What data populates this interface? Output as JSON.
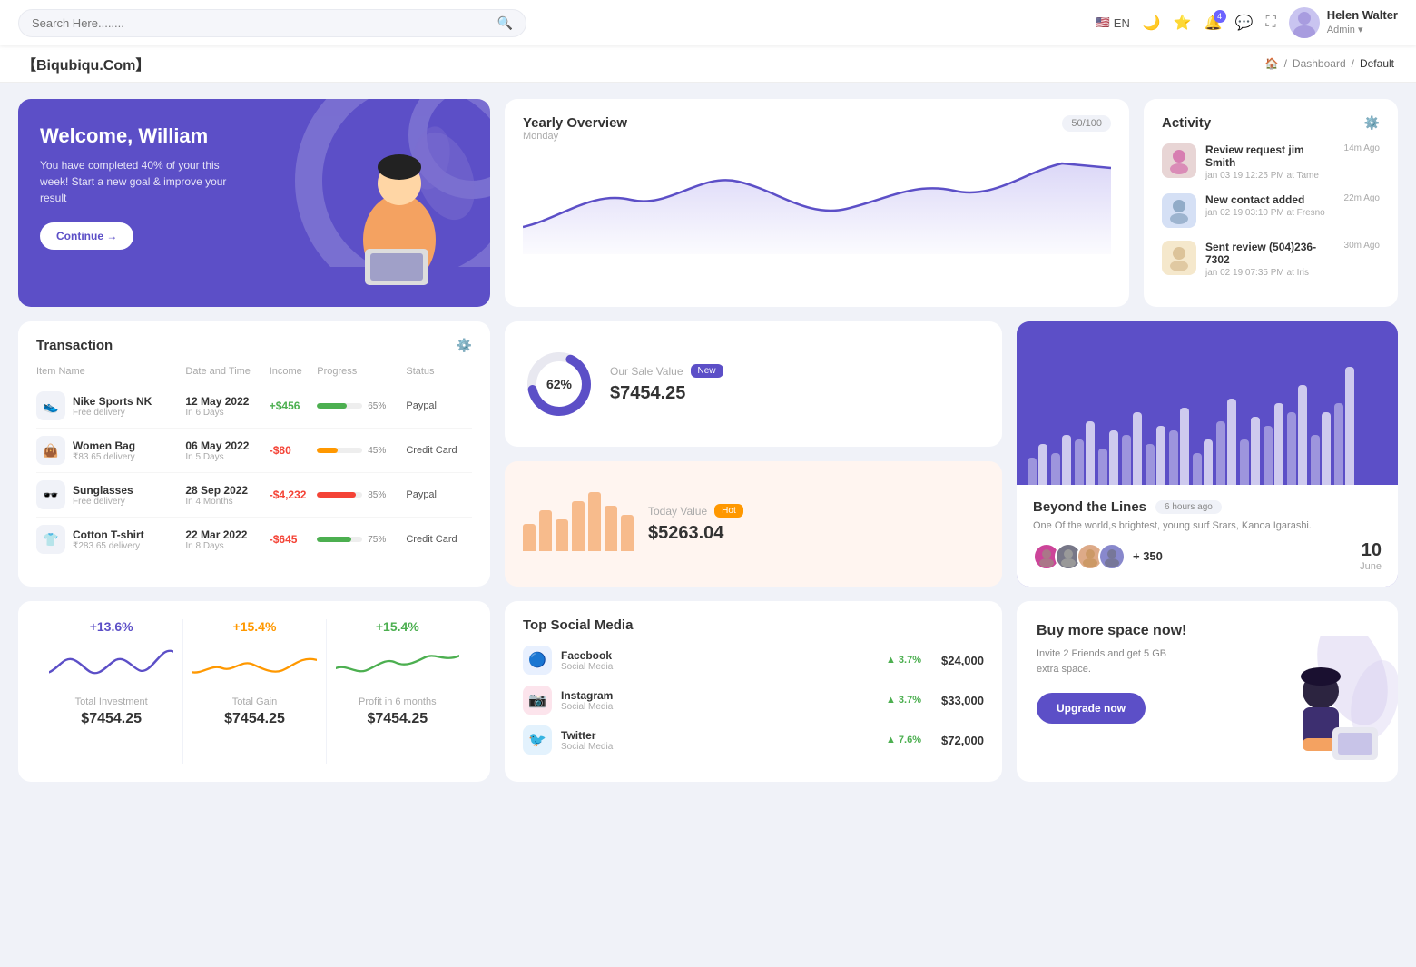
{
  "header": {
    "search_placeholder": "Search Here........",
    "lang": "EN",
    "notification_count": "4",
    "user_name": "Helen Walter",
    "user_role": "Admin"
  },
  "breadcrumb": {
    "brand": "【Biqubiqu.Com】",
    "path": [
      "Home",
      "Dashboard",
      "Default"
    ]
  },
  "welcome": {
    "title": "Welcome, William",
    "description": "You have completed 40% of your this week! Start a new goal & improve your result",
    "button": "Continue →"
  },
  "yearly_overview": {
    "title": "Yearly Overview",
    "subtitle": "Monday",
    "badge": "50/100"
  },
  "activity": {
    "title": "Activity",
    "items": [
      {
        "title": "Review request jim Smith",
        "desc": "jan 03 19 12:25 PM at Tame",
        "time": "14m Ago"
      },
      {
        "title": "New contact added",
        "desc": "jan 02 19 03:10 PM at Fresno",
        "time": "22m Ago"
      },
      {
        "title": "Sent review (504)236-7302",
        "desc": "jan 02 19 07:35 PM at Iris",
        "time": "30m Ago"
      }
    ]
  },
  "transaction": {
    "title": "Transaction",
    "columns": [
      "Item Name",
      "Date and Time",
      "Income",
      "Progress",
      "Status"
    ],
    "rows": [
      {
        "icon": "👟",
        "name": "Nike Sports NK",
        "sub": "Free delivery",
        "date": "12 May 2022",
        "period": "In 6 Days",
        "income": "+$456",
        "income_type": "pos",
        "progress": 65,
        "progress_color": "#4caf50",
        "status": "Paypal"
      },
      {
        "icon": "👜",
        "name": "Women Bag",
        "sub": "₹83.65 delivery",
        "date": "06 May 2022",
        "period": "In 5 Days",
        "income": "-$80",
        "income_type": "neg",
        "progress": 45,
        "progress_color": "#ff9800",
        "status": "Credit Card"
      },
      {
        "icon": "🕶️",
        "name": "Sunglasses",
        "sub": "Free delivery",
        "date": "28 Sep 2022",
        "period": "In 4 Months",
        "income": "-$4,232",
        "income_type": "neg",
        "progress": 85,
        "progress_color": "#f44336",
        "status": "Paypal"
      },
      {
        "icon": "👕",
        "name": "Cotton T-shirt",
        "sub": "₹283.65 delivery",
        "date": "22 Mar 2022",
        "period": "In 8 Days",
        "income": "-$645",
        "income_type": "neg",
        "progress": 75,
        "progress_color": "#4caf50",
        "status": "Credit Card"
      }
    ]
  },
  "sale_value": {
    "title": "Our Sale Value",
    "value": "$7454.25",
    "percent": "62%",
    "badge": "New"
  },
  "today_value": {
    "title": "Today Value",
    "value": "$5263.04",
    "badge": "Hot",
    "bars": [
      30,
      45,
      35,
      55,
      65,
      50,
      40
    ]
  },
  "beyond": {
    "title": "Beyond the Lines",
    "time": "6 hours ago",
    "description": "One Of the world,s brightest, young surf Srars, Kanoa Igarashi.",
    "plus_count": "+ 350",
    "date_num": "10",
    "date_month": "June"
  },
  "stats": [
    {
      "percent": "+13.6%",
      "label": "Total Investment",
      "value": "$7454.25",
      "color": "#5c4fc7"
    },
    {
      "percent": "+15.4%",
      "label": "Total Gain",
      "value": "$7454.25",
      "color": "#ff9800"
    },
    {
      "percent": "+15.4%",
      "label": "Profit in 6 months",
      "value": "$7454.25",
      "color": "#4caf50"
    }
  ],
  "social_media": {
    "title": "Top Social Media",
    "items": [
      {
        "name": "Facebook",
        "sub": "Social Media",
        "growth": "3.7%",
        "revenue": "$24,000",
        "color": "#1877f2",
        "icon": "f"
      },
      {
        "name": "Instagram",
        "sub": "Social Media",
        "growth": "3.7%",
        "revenue": "$33,000",
        "color": "#e1306c",
        "icon": "📷"
      },
      {
        "name": "Twitter",
        "sub": "Social Media",
        "growth": "7.6%",
        "revenue": "$72,000",
        "color": "#1da1f2",
        "icon": "🐦"
      }
    ]
  },
  "buy_space": {
    "title": "Buy more space now!",
    "description": "Invite 2 Friends and get 5 GB extra space.",
    "button": "Upgrade now"
  }
}
